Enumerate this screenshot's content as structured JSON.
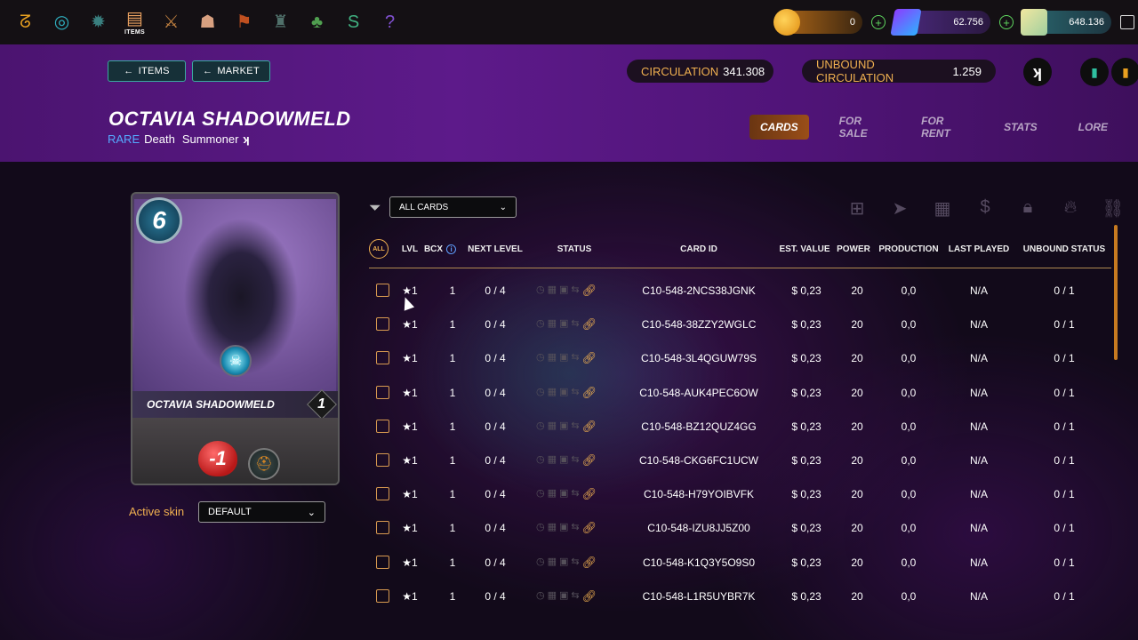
{
  "topnav": {
    "items": [
      {
        "name": "logo",
        "glyph": "ᘔ",
        "color": "#e8a020",
        "label": ""
      },
      {
        "name": "swirl",
        "glyph": "◎",
        "color": "#2fb0c0",
        "label": ""
      },
      {
        "name": "gear",
        "glyph": "✹",
        "color": "#3a8080",
        "label": ""
      },
      {
        "name": "items",
        "glyph": "▤",
        "color": "#e8a060",
        "label": "ITEMS"
      },
      {
        "name": "sword",
        "glyph": "⚔",
        "color": "#c08040",
        "label": ""
      },
      {
        "name": "chest",
        "glyph": "☗",
        "color": "#d8a080",
        "label": ""
      },
      {
        "name": "banner",
        "glyph": "⚑",
        "color": "#c05020",
        "label": ""
      },
      {
        "name": "castle",
        "glyph": "♜",
        "color": "#50706a",
        "label": ""
      },
      {
        "name": "tree",
        "glyph": "♣",
        "color": "#50a050",
        "label": ""
      },
      {
        "name": "serpent",
        "glyph": "S",
        "color": "#40b080",
        "label": ""
      },
      {
        "name": "question",
        "glyph": "?",
        "color": "#8050d0",
        "label": ""
      }
    ]
  },
  "currencies": {
    "dec": "0",
    "sps": "62.756",
    "voucher": "648.136"
  },
  "header": {
    "back_items": "ITEMS",
    "back_market": "MARKET",
    "circulation_label": "CIRCULATION",
    "circulation_value": "341.308",
    "unbound_label": "UNBOUND CIRCULATION",
    "unbound_value": "1.259",
    "title": "OCTAVIA SHADOWMELD",
    "rarity": "RARE",
    "element": "Death",
    "type": "Summoner",
    "tabs": [
      "CARDS",
      "FOR SALE",
      "FOR RENT",
      "STATS",
      "LORE"
    ]
  },
  "card": {
    "mana": "6",
    "name": "OCTAVIA SHADOWMELD",
    "level": "1",
    "health_mod": "-1",
    "skin_label": "Active skin",
    "skin_value": "DEFAULT"
  },
  "filter": {
    "value": "ALL CARDS"
  },
  "table": {
    "all_label": "ALL",
    "headers": {
      "lvl": "LVL",
      "bcx": "BCX",
      "next": "NEXT LEVEL",
      "status": "STATUS",
      "card_id": "CARD ID",
      "est_value": "EST. VALUE",
      "power": "POWER",
      "production": "PRODUCTION",
      "last_played": "LAST PLAYED",
      "unbound": "UNBOUND STATUS"
    },
    "rows": [
      {
        "lvl": "★1",
        "bcx": "1",
        "next": "0 / 4",
        "id": "C10-548-2NCS38JGNK",
        "value": "$ 0,23",
        "power": "20",
        "prod": "0,0",
        "played": "N/A",
        "unbound": "0 / 1"
      },
      {
        "lvl": "★1",
        "bcx": "1",
        "next": "0 / 4",
        "id": "C10-548-38ZZY2WGLC",
        "value": "$ 0,23",
        "power": "20",
        "prod": "0,0",
        "played": "N/A",
        "unbound": "0 / 1"
      },
      {
        "lvl": "★1",
        "bcx": "1",
        "next": "0 / 4",
        "id": "C10-548-3L4QGUW79S",
        "value": "$ 0,23",
        "power": "20",
        "prod": "0,0",
        "played": "N/A",
        "unbound": "0 / 1"
      },
      {
        "lvl": "★1",
        "bcx": "1",
        "next": "0 / 4",
        "id": "C10-548-AUK4PEC6OW",
        "value": "$ 0,23",
        "power": "20",
        "prod": "0,0",
        "played": "N/A",
        "unbound": "0 / 1"
      },
      {
        "lvl": "★1",
        "bcx": "1",
        "next": "0 / 4",
        "id": "C10-548-BZ12QUZ4GG",
        "value": "$ 0,23",
        "power": "20",
        "prod": "0,0",
        "played": "N/A",
        "unbound": "0 / 1"
      },
      {
        "lvl": "★1",
        "bcx": "1",
        "next": "0 / 4",
        "id": "C10-548-CKG6FC1UCW",
        "value": "$ 0,23",
        "power": "20",
        "prod": "0,0",
        "played": "N/A",
        "unbound": "0 / 1"
      },
      {
        "lvl": "★1",
        "bcx": "1",
        "next": "0 / 4",
        "id": "C10-548-H79YOIBVFK",
        "value": "$ 0,23",
        "power": "20",
        "prod": "0,0",
        "played": "N/A",
        "unbound": "0 / 1"
      },
      {
        "lvl": "★1",
        "bcx": "1",
        "next": "0 / 4",
        "id": "C10-548-IZU8JJ5Z00",
        "value": "$ 0,23",
        "power": "20",
        "prod": "0,0",
        "played": "N/A",
        "unbound": "0 / 1"
      },
      {
        "lvl": "★1",
        "bcx": "1",
        "next": "0 / 4",
        "id": "C10-548-K1Q3Y5O9S0",
        "value": "$ 0,23",
        "power": "20",
        "prod": "0,0",
        "played": "N/A",
        "unbound": "0 / 1"
      },
      {
        "lvl": "★1",
        "bcx": "1",
        "next": "0 / 4",
        "id": "C10-548-L1R5UYBR7K",
        "value": "$ 0,23",
        "power": "20",
        "prod": "0,0",
        "played": "N/A",
        "unbound": "0 / 1"
      }
    ]
  },
  "colors": {
    "accent_orange": "#f0b050",
    "teal_border": "#3aa9a0",
    "header_purple": "#5d1a8a"
  }
}
